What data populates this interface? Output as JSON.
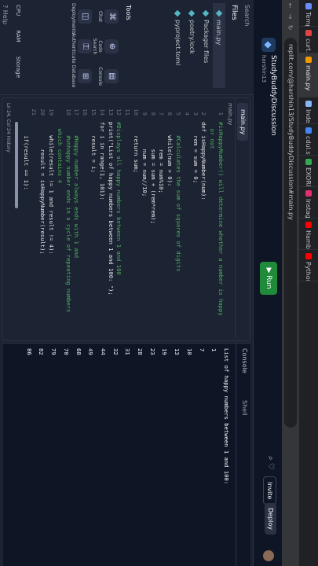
{
  "browser": {
    "tabs": [
      {
        "label": "Templates",
        "color": "#6b8cff"
      },
      {
        "label": "curt.sam",
        "color": "#d44"
      },
      {
        "label": "main.py",
        "color": "#f29900",
        "active": true
      },
      {
        "label": "Index - M",
        "color": "#8ab4f8"
      },
      {
        "label": "cdul.sfgo",
        "color": "#4285f4"
      },
      {
        "label": "EXOR80",
        "color": "#34a853"
      },
      {
        "label": "Instagram",
        "color": "#e1306c"
      },
      {
        "label": "Hambo Tr",
        "color": "#ff0000"
      },
      {
        "label": "Python pr",
        "color": "#ff0000"
      }
    ],
    "url": "replit.com/@harshin13/StudyBuddyDiscussion#main.py"
  },
  "header": {
    "project_name": "StudyBuddyDiscussion",
    "username": "harshin13",
    "run_label": "Run",
    "invite_label": "Invite",
    "deploy_label": "Deploy",
    "icons": "⌕ ♡"
  },
  "sidebar": {
    "search_label": "Search",
    "files_title": "Files",
    "files": [
      "main.py",
      "Packager files",
      "poetry.lock",
      "pyproject.toml"
    ],
    "tools_title": "Tools",
    "tools": [
      {
        "icon": "⌘",
        "label": "Chat"
      },
      {
        "icon": "⊕",
        "label": "Code Search"
      },
      {
        "icon": "▤",
        "label": "Console"
      },
      {
        "icon": "◫",
        "label": "Deployments"
      },
      {
        "icon": "⚿",
        "label": "Authenticate"
      },
      {
        "icon": "⊞",
        "label": "Database"
      }
    ],
    "usage": [
      "CPU",
      "RAM",
      "Storage"
    ],
    "help_label": "? Help"
  },
  "editor": {
    "tab_label": "main.py",
    "crumb": "main.py",
    "lines": [
      "#isHappyNumber() will determine whether a number is happy",
      "  or not",
      "def isHappyNumber(num):",
      "    rem = sum = 0;",
      "",
      "    #Calculates the sum of squares of digits",
      "    while(num > 0):",
      "        rem = num%10;",
      "        sum = sum + (rem*rem);",
      "        num = num//10;",
      "    return sum;",
      "",
      "#Displays all happy numbers between 1 and 100",
      "print(\"List of happy numbers between 1 and 100: \");",
      "for i in range(1, 101):",
      "    result = i;",
      "",
      "    #Happy number always ends with 1 and",
      "    #unhappy number ends in a cycle of repeating numbers",
      "  which contains 4",
      "    while(result != 1 and result != 4):",
      "        result = isHappyNumber(result);",
      "",
      "    if(result == 1):"
    ],
    "line_numbers": [
      "1",
      "",
      "2",
      "3",
      "4",
      "5",
      "6",
      "7",
      "8",
      "9",
      "10",
      "11",
      "12",
      "13",
      "14",
      "15",
      "16",
      "17",
      "18",
      "",
      "19",
      "20",
      "21",
      ""
    ],
    "status": "Ln 24, Col 24  History"
  },
  "console": {
    "tab_console": "Console",
    "tab_shell": "Shell",
    "output": [
      "List of happy numbers between 1 and 100:",
      "1",
      "7",
      "10",
      "13",
      "19",
      "23",
      "28",
      "31",
      "32",
      "44",
      "49",
      "68",
      "70",
      "79",
      "82",
      "86"
    ]
  }
}
